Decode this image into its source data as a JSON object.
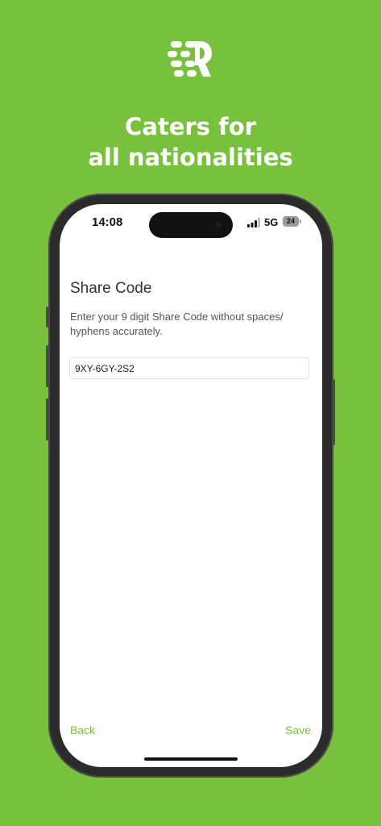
{
  "promo": {
    "headline_line1": "Caters for",
    "headline_line2": "all nationalities"
  },
  "status_bar": {
    "time": "14:08",
    "network": "5G",
    "battery": "24"
  },
  "form": {
    "title": "Share Code",
    "description": "Enter your 9 digit Share Code without spaces/ hyphens accurately.",
    "share_code_value": "9XY-6GY-2S2"
  },
  "footer": {
    "back_label": "Back",
    "save_label": "Save"
  },
  "colors": {
    "brand_green": "#77c13d",
    "background": "#77c13d"
  },
  "icons": [
    "brand-logo-icon",
    "signal-icon",
    "battery-icon"
  ]
}
